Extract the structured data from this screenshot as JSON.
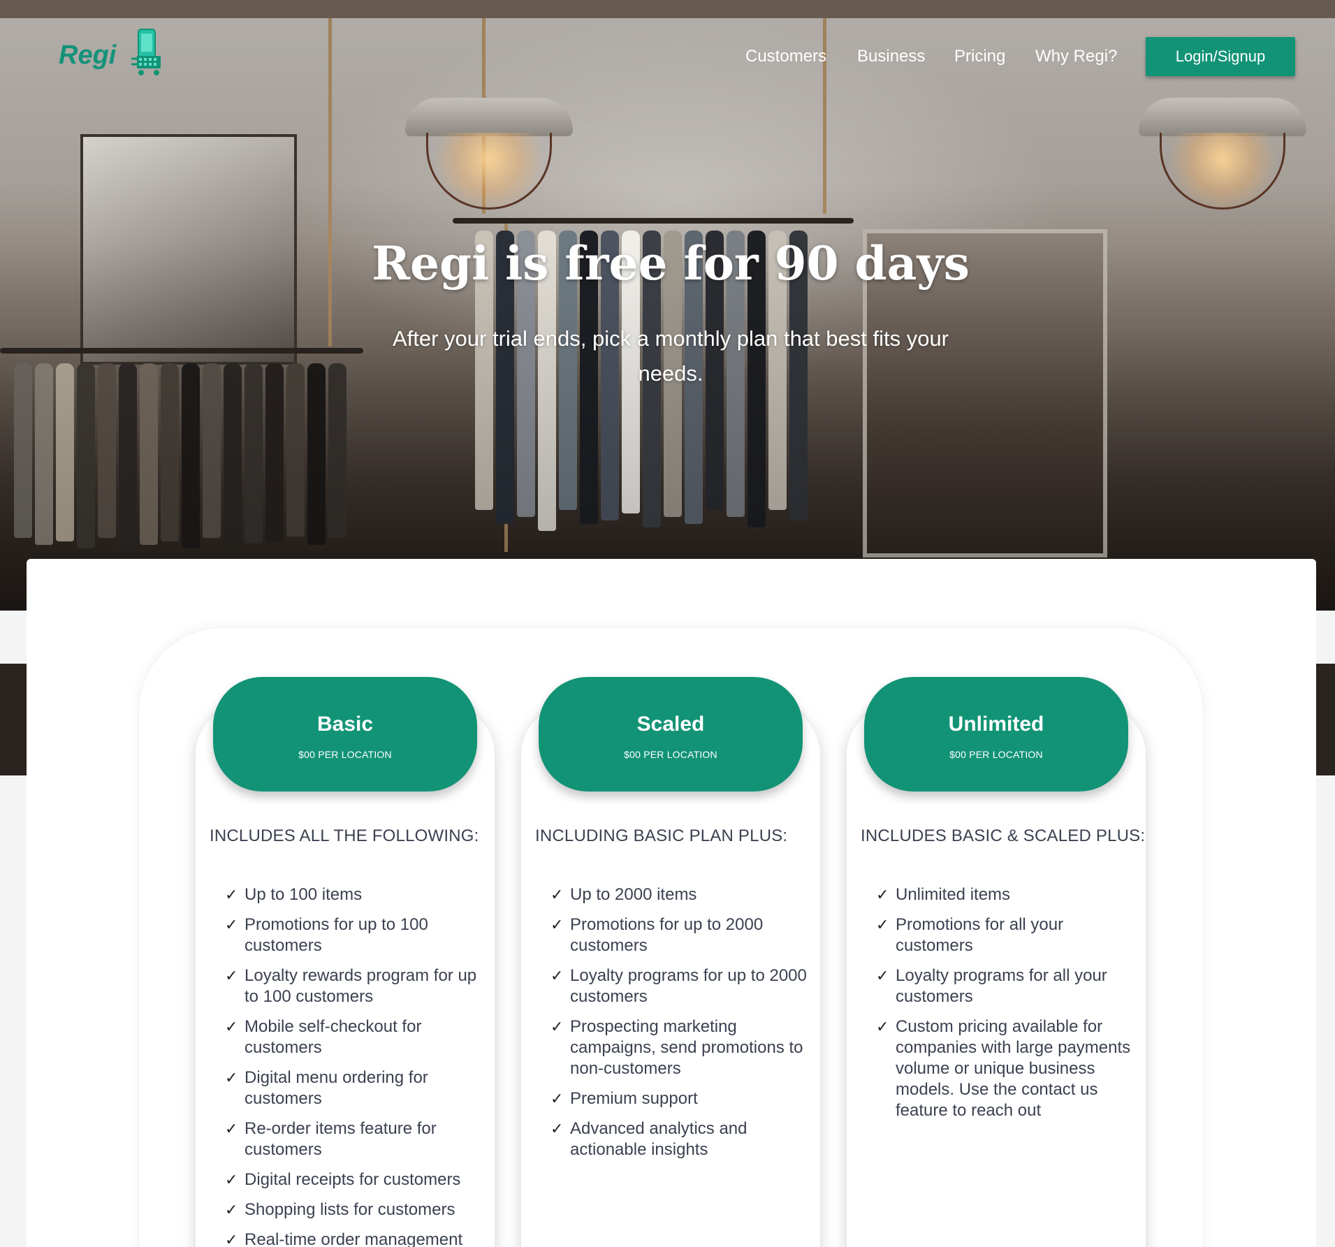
{
  "brand": {
    "logo_text": "Regi",
    "primary_color": "#129376"
  },
  "nav": {
    "items": [
      {
        "label": "Customers"
      },
      {
        "label": "Business"
      },
      {
        "label": "Pricing"
      },
      {
        "label": "Why Regi?"
      }
    ],
    "login_label": "Login/Signup"
  },
  "hero": {
    "title": "Regi is free for 90 days",
    "subtitle": "After your trial ends, pick a monthly plan that best fits your needs."
  },
  "plans": [
    {
      "name": "Basic",
      "price": "$00 PER LOCATION",
      "subtitle": "INCLUDES ALL THE FOLLOWING:",
      "features": [
        "Up to 100 items",
        "Promotions for up to 100 customers",
        "Loyalty rewards program for up to 100 customers",
        "Mobile self-checkout for customers",
        "Digital menu ordering for customers",
        "Re-order items feature for customers",
        "Digital receipts for customers",
        "Shopping lists for customers",
        "Real-time order management"
      ]
    },
    {
      "name": "Scaled",
      "price": "$00 PER LOCATION",
      "subtitle": "INCLUDING BASIC PLAN PLUS:",
      "features": [
        "Up to 2000 items",
        "Promotions for up to 2000 customers",
        "Loyalty programs for up to 2000 customers",
        "Prospecting marketing campaigns, send promotions to non-customers",
        "Premium support",
        "Advanced analytics and actionable insights"
      ]
    },
    {
      "name": "Unlimited",
      "price": "$00 PER LOCATION",
      "subtitle": "INCLUDES BASIC & SCALED PLUS:",
      "features": [
        "Unlimited items",
        "Promotions for all your customers",
        "Loyalty programs for all your customers",
        "Custom pricing available for companies with large payments volume or unique business models. Use the contact us feature to reach out"
      ]
    }
  ],
  "icons": {
    "check": "check-icon",
    "logo": "phone-cart-icon"
  }
}
